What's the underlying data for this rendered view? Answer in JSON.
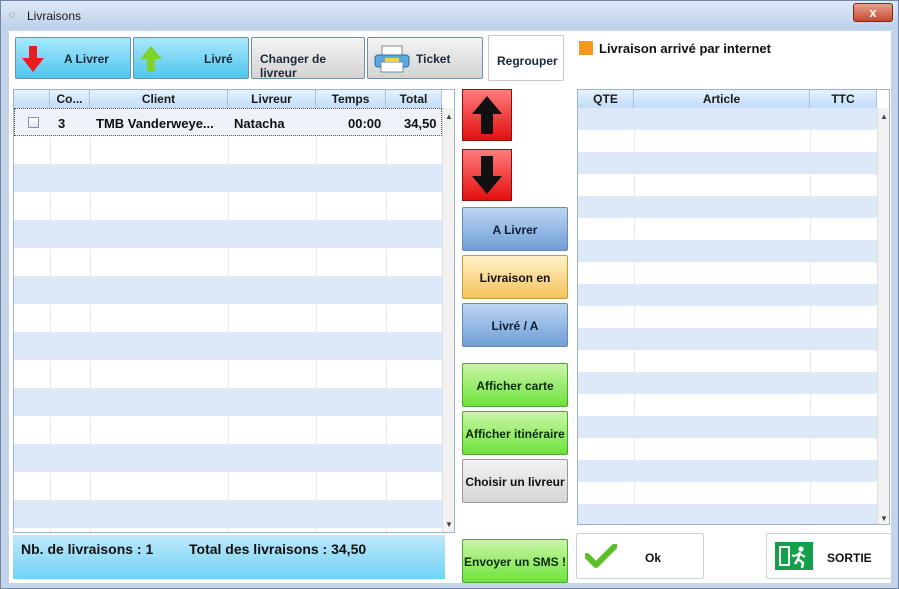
{
  "window": {
    "title": "Livraisons",
    "close_label": "x"
  },
  "toolbar": {
    "a_livrer": "A Livrer",
    "livre": "Livré",
    "changer_livreur": "Changer de livreur",
    "ticket": "Ticket",
    "regrouper": "Regrouper"
  },
  "legend": {
    "text": "Livraison arrivé par internet",
    "color": "#f39a1e"
  },
  "deliveries": {
    "headers": [
      "Co...",
      "Client",
      "Livreur",
      "Temps",
      "Total"
    ],
    "rows": [
      {
        "code": "3",
        "client": "TMB Vanderweye...",
        "livreur": "Natacha",
        "temps": "00:00",
        "total": "34,50"
      }
    ]
  },
  "summary": {
    "count": "Nb. de livraisons : 1",
    "total": "Total des livraisons : 34,50"
  },
  "middle": {
    "a_livrer": "A Livrer",
    "en_cours": "Livraison en cours",
    "livre_encaisser": "Livré / A Encaisser",
    "afficher_carte": "Afficher carte",
    "afficher_itineraire": "Afficher itinéraire",
    "choisir_livreur": "Choisir un livreur",
    "envoyer_sms": "Envoyer un SMS !"
  },
  "articles": {
    "headers": [
      "QTE",
      "Article",
      "TTC"
    ]
  },
  "bottom": {
    "ok": "Ok",
    "sortie": "SORTIE"
  },
  "icons": {
    "down": "red-down-arrow-icon",
    "up": "green-up-arrow-icon",
    "printer": "printer-icon",
    "move_up": "up-arrow-icon",
    "move_down": "down-arrow-icon",
    "check": "checkmark-icon",
    "exit": "exit-door-icon"
  }
}
